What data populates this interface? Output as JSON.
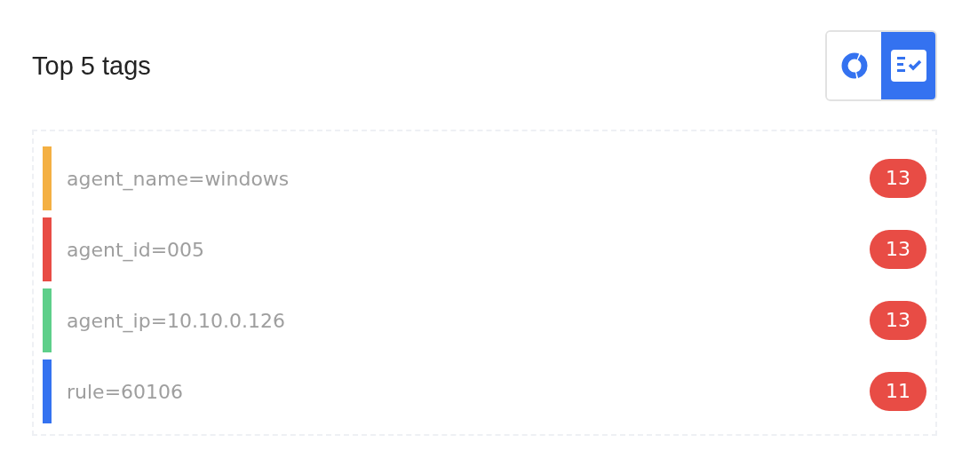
{
  "title": "Top 5 tags",
  "views": [
    {
      "kind": "donut",
      "selected": false
    },
    {
      "kind": "list",
      "selected": true
    }
  ],
  "tags": [
    {
      "label": "agent_name=windows",
      "count": "13",
      "color": "#f4b043"
    },
    {
      "label": "agent_id=005",
      "count": "13",
      "color": "#e84c45"
    },
    {
      "label": "agent_ip=10.10.0.126",
      "count": "13",
      "color": "#5ecf8a"
    },
    {
      "label": "rule=60106",
      "count": "11",
      "color": "#3472f0"
    }
  ]
}
